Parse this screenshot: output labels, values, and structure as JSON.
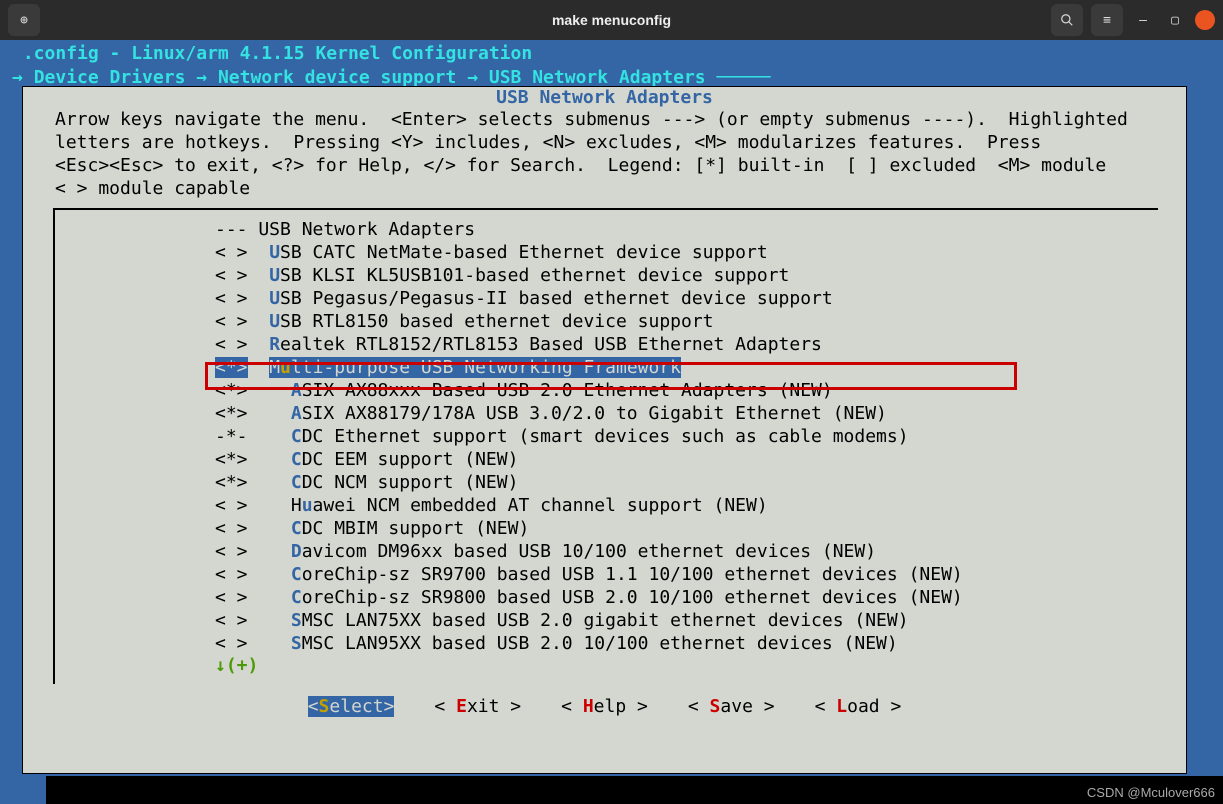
{
  "window": {
    "title": "make menuconfig"
  },
  "header_line1": ".config - Linux/arm 4.1.15 Kernel Configuration",
  "breadcrumb": [
    "Device Drivers",
    "Network device support",
    "USB Network Adapters"
  ],
  "dialog_title": "USB Network Adapters",
  "instructions": "Arrow keys navigate the menu.  <Enter> selects submenus ---> (or empty submenus ----).  Highlighted\nletters are hotkeys.  Pressing <Y> includes, <N> excludes, <M> modularizes features.  Press\n<Esc><Esc> to exit, <?> for Help, </> for Search.  Legend: [*] built-in  [ ] excluded  <M> module\n< > module capable",
  "items": [
    {
      "sym": "---",
      "indent": 0,
      "hot": "",
      "label": "USB Network Adapters",
      "sel": false
    },
    {
      "sym": "< >",
      "indent": 1,
      "hot": "U",
      "label": "SB CATC NetMate-based Ethernet device support",
      "sel": false
    },
    {
      "sym": "< >",
      "indent": 1,
      "hot": "U",
      "label": "SB KLSI KL5USB101-based ethernet device support",
      "sel": false
    },
    {
      "sym": "< >",
      "indent": 1,
      "hot": "U",
      "label": "SB Pegasus/Pegasus-II based ethernet device support",
      "sel": false
    },
    {
      "sym": "< >",
      "indent": 1,
      "hot": "U",
      "label": "SB RTL8150 based ethernet device support",
      "sel": false
    },
    {
      "sym": "< >",
      "indent": 1,
      "hot": "R",
      "label": "ealtek RTL8152/RTL8153 Based USB Ethernet Adapters",
      "sel": false
    },
    {
      "sym": "<*>",
      "indent": 1,
      "hot": "M",
      "pre": "",
      "hot2": "u",
      "label": "lti-purpose USB Networking Framework",
      "sel": true
    },
    {
      "sym": "<*>",
      "indent": 2,
      "hot": "A",
      "label": "SIX AX88xxx Based USB 2.0 Ethernet Adapters (NEW)",
      "sel": false
    },
    {
      "sym": "<*>",
      "indent": 2,
      "hot": "A",
      "label": "SIX AX88179/178A USB 3.0/2.0 to Gigabit Ethernet (NEW)",
      "sel": false
    },
    {
      "sym": "-*-",
      "indent": 2,
      "hot": "C",
      "label": "DC Ethernet support (smart devices such as cable modems)",
      "sel": false
    },
    {
      "sym": "<*>",
      "indent": 2,
      "hot": "C",
      "label": "DC EEM support (NEW)",
      "sel": false
    },
    {
      "sym": "<*>",
      "indent": 2,
      "hot": "C",
      "label": "DC NCM support (NEW)",
      "sel": false
    },
    {
      "sym": "< >",
      "indent": 2,
      "hot": "H",
      "pre": "",
      "hot2": "u",
      "label": "awei NCM embedded AT channel support (NEW)",
      "sel": false,
      "simplehot": "H",
      "label2": "uawei NCM embedded AT channel support (NEW)"
    },
    {
      "sym": "< >",
      "indent": 2,
      "hot": "C",
      "label": "DC MBIM support (NEW)",
      "sel": false
    },
    {
      "sym": "< >",
      "indent": 2,
      "hot": "D",
      "label": "avicom DM96xx based USB 10/100 ethernet devices (NEW)",
      "sel": false
    },
    {
      "sym": "< >",
      "indent": 2,
      "hot": "C",
      "label": "oreChip-sz SR9700 based USB 1.1 10/100 ethernet devices (NEW)",
      "sel": false
    },
    {
      "sym": "< >",
      "indent": 2,
      "hot": "C",
      "label": "oreChip-sz SR9800 based USB 2.0 10/100 ethernet devices (NEW)",
      "sel": false
    },
    {
      "sym": "< >",
      "indent": 2,
      "hot": "S",
      "label": "MSC LAN75XX based USB 2.0 gigabit ethernet devices (NEW)",
      "sel": false
    },
    {
      "sym": "< >",
      "indent": 2,
      "hot": "S",
      "label": "MSC LAN95XX based USB 2.0 10/100 ethernet devices (NEW)",
      "sel": false
    }
  ],
  "scroll_hint": "↓(+)",
  "buttons": [
    {
      "pre": "<",
      "hot": "S",
      "post": "elect>",
      "active": true
    },
    {
      "pre": "< ",
      "hot": "E",
      "post": "xit >",
      "active": false
    },
    {
      "pre": "< ",
      "hot": "H",
      "post": "elp >",
      "active": false
    },
    {
      "pre": "< ",
      "hot": "S",
      "post": "ave >",
      "active": false
    },
    {
      "pre": "< ",
      "hot": "L",
      "post": "oad >",
      "active": false
    }
  ],
  "watermark": "CSDN @Mculover666"
}
